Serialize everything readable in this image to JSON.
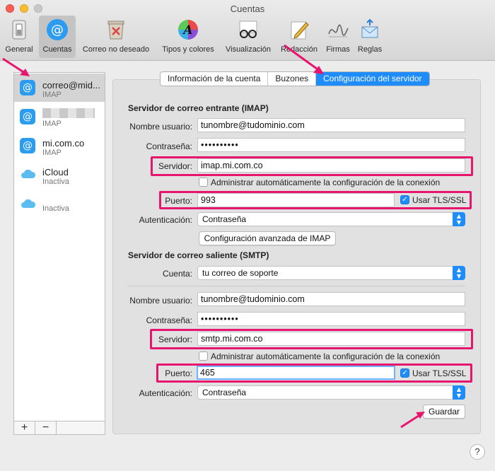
{
  "window": {
    "title": "Cuentas"
  },
  "toolbar": {
    "items": [
      {
        "label": "General"
      },
      {
        "label": "Cuentas"
      },
      {
        "label": "Correo no deseado"
      },
      {
        "label": "Tipos y colores"
      },
      {
        "label": "Visualización"
      },
      {
        "label": "Redacción"
      },
      {
        "label": "Firmas"
      },
      {
        "label": "Reglas"
      }
    ]
  },
  "sidebar": {
    "accounts": [
      {
        "name": "correo@mid...",
        "type": "IMAP"
      },
      {
        "name": "",
        "type": "IMAP"
      },
      {
        "name": "mi.com.co",
        "type": "IMAP"
      },
      {
        "name": "iCloud",
        "type": "Inactiva"
      },
      {
        "name": "",
        "type": "Inactiva"
      }
    ],
    "add_label": "+",
    "remove_label": "−"
  },
  "tabs": [
    {
      "label": "Información de la cuenta"
    },
    {
      "label": "Buzones"
    },
    {
      "label": "Configuración del servidor"
    }
  ],
  "incoming": {
    "title": "Servidor de correo entrante (IMAP)",
    "username_label": "Nombre usuario:",
    "username": "tunombre@tudominio.com",
    "password_label": "Contraseña:",
    "password": "••••••••••",
    "server_label": "Servidor:",
    "server": "imap.mi.com.co",
    "auto_label": "Administrar automáticamente la configuración de la conexión",
    "port_label": "Puerto:",
    "port": "993",
    "tls_label": "Usar TLS/SSL",
    "auth_label": "Autenticación:",
    "auth": "Contraseña",
    "advanced_button": "Configuración avanzada de IMAP"
  },
  "outgoing": {
    "title": "Servidor de correo saliente (SMTP)",
    "account_label": "Cuenta:",
    "account": "tu correo de soporte",
    "username_label": "Nombre usuario:",
    "username": "tunombre@tudominio.com",
    "password_label": "Contraseña:",
    "password": "••••••••••",
    "server_label": "Servidor:",
    "server": "smtp.mi.com.co",
    "auto_label": "Administrar automáticamente la configuración de la conexión",
    "port_label": "Puerto:",
    "port": "465",
    "tls_label": "Usar TLS/SSL",
    "auth_label": "Autenticación:",
    "auth": "Contraseña"
  },
  "save_button": "Guardar",
  "help_label": "?",
  "colors": {
    "accent": "#1e8dfb",
    "highlight": "#e8156e"
  }
}
